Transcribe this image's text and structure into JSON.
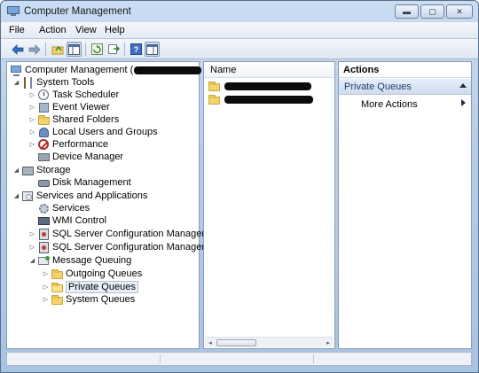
{
  "window": {
    "title": "Computer Management",
    "caption_buttons": [
      {
        "name": "minimize",
        "glyph": "▬"
      },
      {
        "name": "maximize",
        "glyph": "▢"
      },
      {
        "name": "close",
        "glyph": "✕"
      }
    ]
  },
  "menu": [
    "File",
    "Action",
    "View",
    "Help"
  ],
  "toolbar": {
    "buttons": [
      "back-arrow-icon",
      "forward-arrow-icon",
      "up-folder-icon",
      "show-hide-tree-icon",
      "refresh-icon",
      "export-list-icon",
      "help-icon",
      "show-hide-action-pane-icon"
    ]
  },
  "tree": {
    "root": {
      "label": "Computer Management (",
      "redacted": true
    },
    "items": [
      {
        "label": "System Tools",
        "expander": "◢",
        "icon": "tools-icon"
      },
      {
        "label": "Task Scheduler",
        "expander": "▷",
        "icon": "clock-icon"
      },
      {
        "label": "Event Viewer",
        "expander": "▷",
        "icon": "book-icon"
      },
      {
        "label": "Shared Folders",
        "expander": "▷",
        "icon": "folder-icon"
      },
      {
        "label": "Local Users and Groups",
        "expander": "▷",
        "icon": "users-icon"
      },
      {
        "label": "Performance",
        "expander": "▷",
        "icon": "no-entry-icon"
      },
      {
        "label": "Device Manager",
        "expander": "",
        "icon": "device-icon"
      },
      {
        "label": "Storage",
        "expander": "◢",
        "icon": "storage-icon"
      },
      {
        "label": "Disk Management",
        "expander": "",
        "icon": "disk-icon"
      },
      {
        "label": "Services and Applications",
        "expander": "◢",
        "icon": "services-apps-icon"
      },
      {
        "label": "Services",
        "expander": "",
        "icon": "gear-icon"
      },
      {
        "label": "WMI Control",
        "expander": "",
        "icon": "wmi-icon"
      },
      {
        "label": "SQL Server Configuration Manager",
        "expander": "▷",
        "icon": "sql-icon"
      },
      {
        "label": "SQL Server Configuration Manager",
        "expander": "▷",
        "icon": "sql-icon"
      },
      {
        "label": "Message Queuing",
        "expander": "◢",
        "icon": "message-queue-icon"
      },
      {
        "label": "Outgoing Queues",
        "expander": "▷",
        "icon": "folder-icon"
      },
      {
        "label": "Private Queues",
        "expander": "▷",
        "icon": "folder-open-icon",
        "selected": true
      },
      {
        "label": "System Queues",
        "expander": "▷",
        "icon": "folder-icon"
      }
    ]
  },
  "list": {
    "column_name": "Name",
    "rows": [
      {
        "label": "",
        "redacted": true
      },
      {
        "label": "",
        "redacted": true
      }
    ],
    "hscroll": {
      "left": "◂",
      "right": "▸"
    }
  },
  "actions": {
    "title": "Actions",
    "group": "Private Queues",
    "items": [
      "More Actions"
    ]
  }
}
